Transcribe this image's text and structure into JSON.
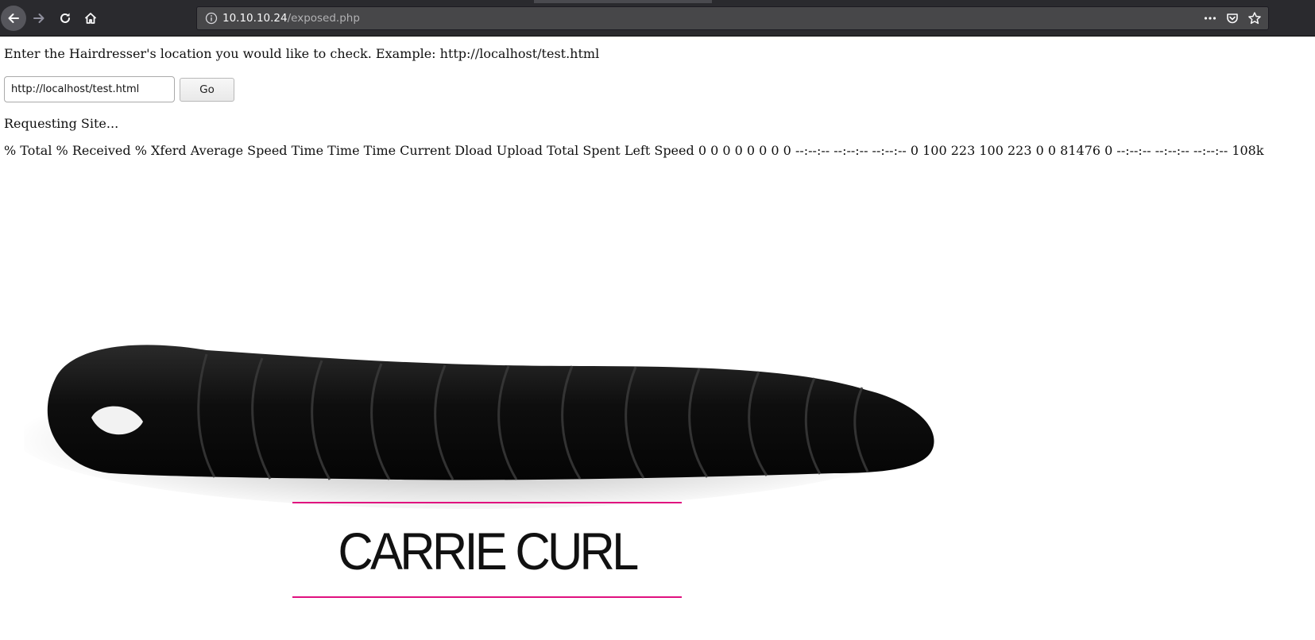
{
  "browser": {
    "url_host": "10.10.10.24",
    "url_path": "/exposed.php",
    "icons": [
      "back-arrow-icon",
      "forward-arrow-icon",
      "reload-icon",
      "home-icon",
      "info-icon",
      "more-icon",
      "pocket-icon",
      "star-icon"
    ]
  },
  "form": {
    "instructions": "Enter the Hairdresser's location you would like to check. Example: http://localhost/test.html",
    "input_value": "http://localhost/test.html",
    "go_label": "Go"
  },
  "result": {
    "requesting": "Requesting Site...",
    "curl_output": "% Total % Received % Xferd Average Speed Time Time Time Current Dload Upload Total Spent Left Speed 0 0 0 0 0 0 0 0 --:--:-- --:--:-- --:--:-- 0 100 223 100 223 0 0 81476 0 --:--:-- --:--:-- --:--:-- 108k"
  },
  "image": {
    "brand_text": "CARRIE CURL",
    "accent_color": "#e0117f"
  }
}
